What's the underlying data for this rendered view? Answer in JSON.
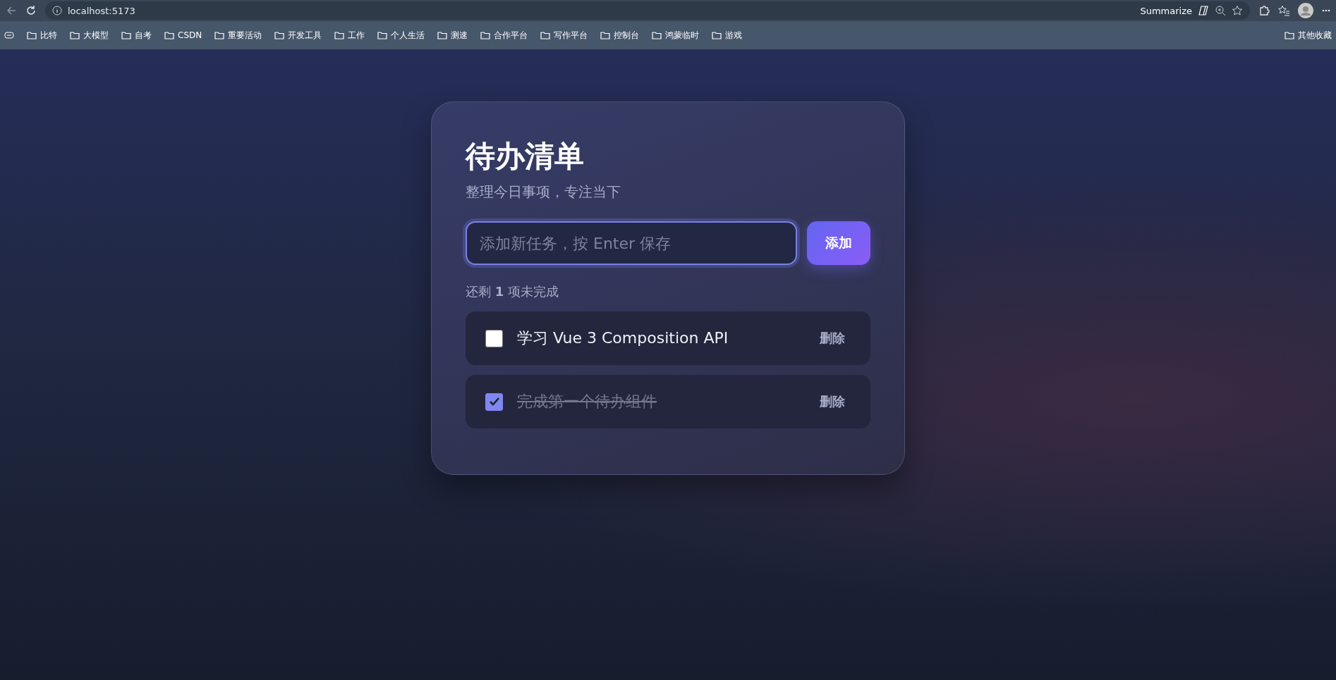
{
  "browser": {
    "address": "localhost:5173",
    "summarize": "Summarize",
    "bookmarks": [
      "比特",
      "大模型",
      "自考",
      "CSDN",
      "重要活动",
      "开发工具",
      "工作",
      "个人生活",
      "测速",
      "合作平台",
      "写作平台",
      "控制台",
      "鸿蒙临时",
      "游戏"
    ],
    "other_bookmarks": "其他收藏"
  },
  "card": {
    "title": "待办清单",
    "subtitle": "整理今日事项，专注当下",
    "input": {
      "placeholder": "添加新任务，按 Enter 保存"
    },
    "add_button": "添加",
    "remaining": "还剩 **1** 项未完成",
    "todos": [
      {
        "text": "学习 Vue 3 Composition API",
        "done": false,
        "delete": "删除"
      },
      {
        "text": "完成第一个待办组件",
        "done": true,
        "delete": "删除"
      }
    ]
  }
}
